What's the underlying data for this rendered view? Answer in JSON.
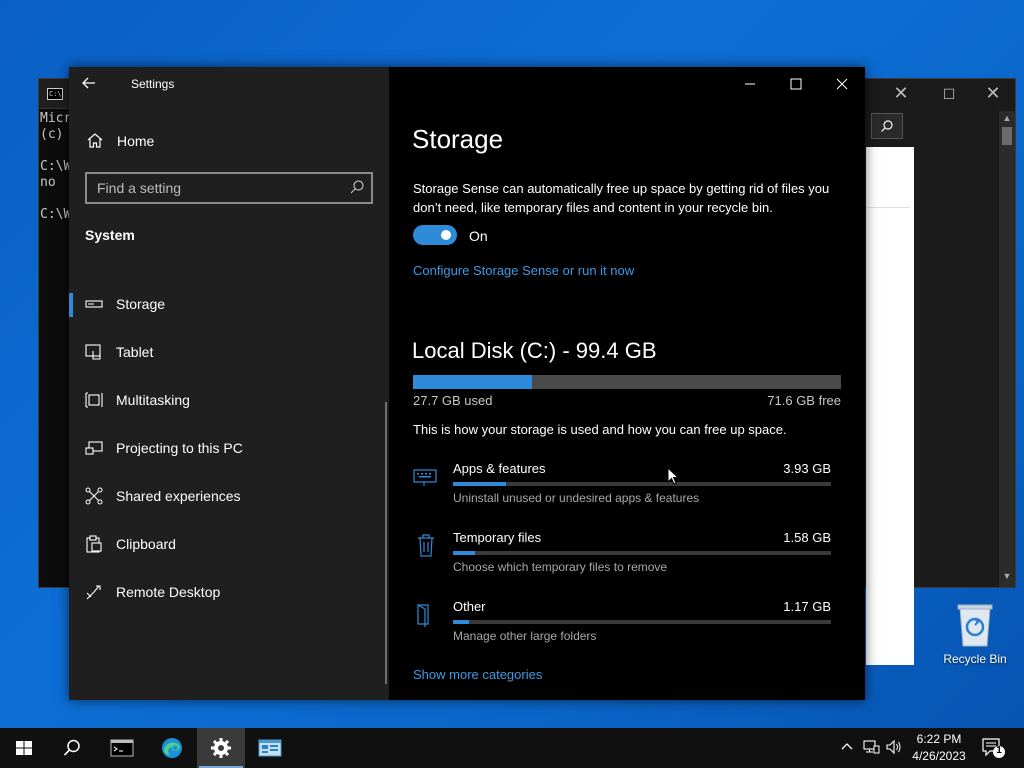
{
  "console": {
    "lines": [
      "Micr",
      "(c)",
      "",
      "C:\\W",
      "no",
      "",
      "C:\\W"
    ]
  },
  "settings": {
    "title": "Settings",
    "home": "Home",
    "search_placeholder": "Find a setting",
    "section": "System",
    "nav": [
      {
        "label": "Storage",
        "icon": "storage-icon",
        "active": true
      },
      {
        "label": "Tablet",
        "icon": "tablet-icon"
      },
      {
        "label": "Multitasking",
        "icon": "multitasking-icon"
      },
      {
        "label": "Projecting to this PC",
        "icon": "projecting-icon"
      },
      {
        "label": "Shared experiences",
        "icon": "shared-experiences-icon"
      },
      {
        "label": "Clipboard",
        "icon": "clipboard-icon"
      },
      {
        "label": "Remote Desktop",
        "icon": "remote-desktop-icon"
      }
    ]
  },
  "storage": {
    "title": "Storage",
    "description": "Storage Sense can automatically free up space by getting rid of files you don’t need, like temporary files and content in your recycle bin.",
    "toggle_state": "On",
    "configure_link": "Configure Storage Sense or run it now",
    "disk_title": "Local Disk (C:) - 99.4 GB",
    "used": "27.7 GB used",
    "free": "71.6 GB free",
    "used_fraction": 0.279,
    "how_used": "This is how your storage is used and how you can free up space.",
    "categories": [
      {
        "name": "Apps & features",
        "size": "3.93 GB",
        "sub": "Uninstall unused or undesired apps & features",
        "fraction": 0.14,
        "icon": "keyboard-icon"
      },
      {
        "name": "Temporary files",
        "size": "1.58 GB",
        "sub": "Choose which temporary files to remove",
        "fraction": 0.057,
        "icon": "trash-icon"
      },
      {
        "name": "Other",
        "size": "1.17 GB",
        "sub": "Manage other large folders",
        "fraction": 0.042,
        "icon": "folder-icon"
      }
    ],
    "show_more": "Show more categories"
  },
  "desktop": {
    "recycle_bin": "Recycle Bin"
  },
  "taskbar": {
    "time": "6:22 PM",
    "date": "4/26/2023",
    "notification_count": "1"
  },
  "colors": {
    "accent": "#2e8bd8",
    "link": "#3d9ae2"
  }
}
